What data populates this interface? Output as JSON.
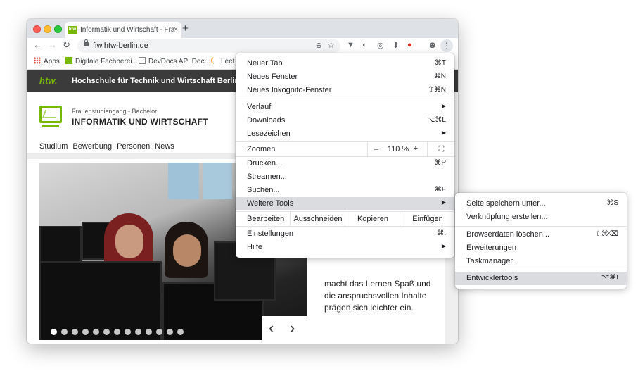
{
  "tab": {
    "favicon_text": "htw",
    "title": "Informatik und Wirtschaft - Fra",
    "close": "×",
    "new_tab": "+"
  },
  "toolbar": {
    "back": "←",
    "forward": "→",
    "reload": "↻",
    "url": "fiw.htw-berlin.de",
    "zoom_icon": "⊕",
    "star_icon": "☆",
    "menu_icon": "⋮"
  },
  "extensions": [
    "ext-filter-icon",
    "ext-moon-icon",
    "ext-code-icon",
    "ext-download-icon",
    "ext-color-icon",
    "profile-icon"
  ],
  "bookmarks": [
    {
      "label": "Apps",
      "icon": "apps-grid-icon",
      "color": "#e8453c"
    },
    {
      "label": "Digitale Fachberei...",
      "icon": "htw-favicon",
      "color": "#76b900"
    },
    {
      "label": "DevDocs API Doc...",
      "icon": "devdocs-icon",
      "color": "#888888"
    },
    {
      "label": "Leet",
      "icon": "leetcode-icon",
      "color": "#f89f1b"
    }
  ],
  "site": {
    "logo": "htw.",
    "university": "Hochschule für Technik und Wirtschaft Berlin",
    "subtitle": "Frauenstudiengang - Bachelor",
    "program": "INFORMATIK UND WIRTSCHAFT",
    "nav": [
      "Studium",
      "Bewerbung",
      "Personen",
      "News"
    ],
    "hero_text": "macht das Lernen Spaß und die anspruchsvollen Inhalte prägen sich leichter ein.",
    "slides": 13,
    "active_slide": 0,
    "prev_arrow": "‹",
    "next_arrow": "›"
  },
  "menu": {
    "items": [
      {
        "label": "Neuer Tab",
        "shortcut": "⌘T"
      },
      {
        "label": "Neues Fenster",
        "shortcut": "⌘N"
      },
      {
        "label": "Neues Inkognito-Fenster",
        "shortcut": "⇧⌘N"
      },
      {
        "label": "Verlauf",
        "arrow": "▶"
      },
      {
        "label": "Downloads",
        "shortcut": "⌥⌘L"
      },
      {
        "label": "Lesezeichen",
        "arrow": "▶"
      },
      {
        "label": "Drucken...",
        "shortcut": "⌘P"
      },
      {
        "label": "Streamen..."
      },
      {
        "label": "Suchen...",
        "shortcut": "⌘F"
      },
      {
        "label": "Weitere Tools",
        "arrow": "▶",
        "highlighted": true
      },
      {
        "label": "Einstellungen",
        "shortcut": "⌘,"
      },
      {
        "label": "Hilfe",
        "arrow": "▶"
      }
    ],
    "zoom": {
      "label": "Zoomen",
      "minus": "–",
      "value": "110 %",
      "plus": "+",
      "fullscreen": "⛶"
    },
    "edit": {
      "label": "Bearbeiten",
      "cut": "Ausschneiden",
      "copy": "Kopieren",
      "paste": "Einfügen"
    }
  },
  "submenu": {
    "items": [
      {
        "label": "Seite speichern unter...",
        "shortcut": "⌘S"
      },
      {
        "label": "Verknüpfung erstellen..."
      },
      {
        "label": "Browserdaten löschen...",
        "shortcut": "⇧⌘⌫"
      },
      {
        "label": "Erweiterungen"
      },
      {
        "label": "Taskmanager"
      },
      {
        "label": "Entwicklertools",
        "shortcut": "⌥⌘I",
        "highlighted": true
      }
    ]
  }
}
